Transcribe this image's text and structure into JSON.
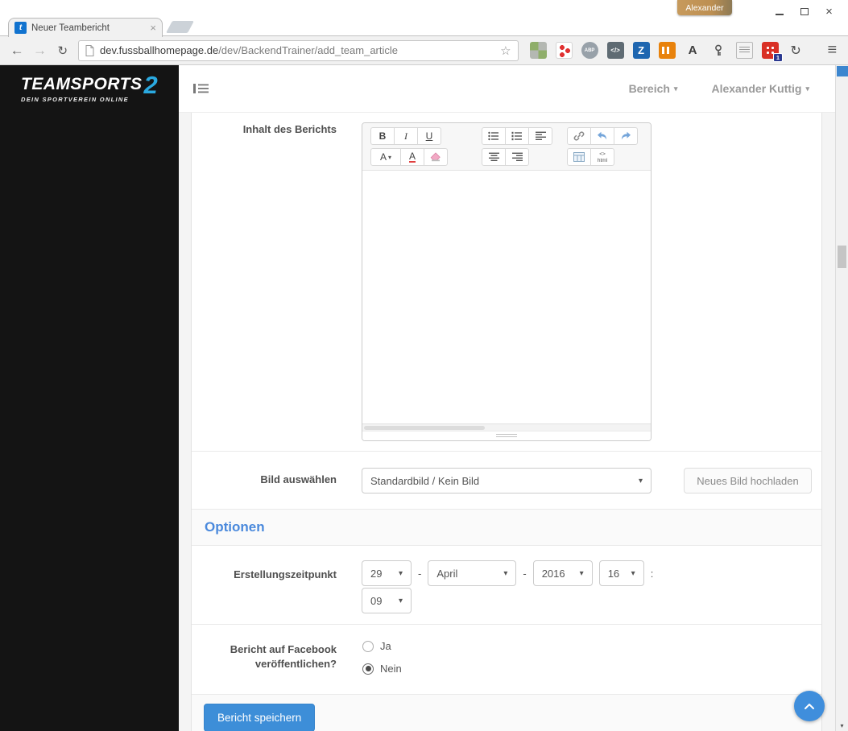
{
  "window": {
    "session_tab_label": "Alexander"
  },
  "browser": {
    "tab": {
      "favicon_letter": "t",
      "title": "Neuer Teambericht"
    },
    "url_domain": "dev.fussballhomepage.de",
    "url_path": "/dev/BackendTrainer/add_team_article",
    "extensions": {
      "abp_label": "ABP",
      "code_label": "</>",
      "z_label": "Z",
      "a_label": "A",
      "badge_count": "1"
    }
  },
  "sidebar": {
    "logo_text": "TEAMSPORTS",
    "logo_number": "2",
    "logo_tagline": "DEIN SPORTVEREIN ONLINE"
  },
  "topbar": {
    "area_menu": "Bereich",
    "user_menu": "Alexander Kuttig"
  },
  "editor": {
    "label": "Inhalt des Berichts",
    "toolbar": {
      "bold": "B",
      "italic": "I",
      "underline": "U",
      "font_color": "A",
      "text_color": "A",
      "html_glyph": "<>",
      "html_label": "html"
    }
  },
  "image_row": {
    "label": "Bild auswählen",
    "select_value": "Standardbild / Kein Bild",
    "upload_button": "Neues Bild hochladen"
  },
  "options": {
    "heading": "Optionen",
    "datetime": {
      "label": "Erstellungszeitpunkt",
      "day": "29",
      "month": "April",
      "year": "2016",
      "hour": "16",
      "minute": "09",
      "sep_dash": "-",
      "sep_colon": ":"
    },
    "facebook": {
      "label_line1": "Bericht auf Facebook",
      "label_line2": "veröffentlichen?",
      "yes": "Ja",
      "no": "Nein"
    }
  },
  "footer": {
    "save_button": "Bericht speichern"
  },
  "icons": {
    "close": "×",
    "back": "←",
    "forward": "→",
    "refresh": "↻",
    "star": "☆",
    "menu": "≡",
    "caret": "▾",
    "sync": "↻"
  },
  "colors": {
    "accent_blue": "#3d8ed8",
    "heading_blue": "#4a89dc",
    "sidebar_bg": "#141414",
    "logo_blue": "#2aa9e0"
  }
}
